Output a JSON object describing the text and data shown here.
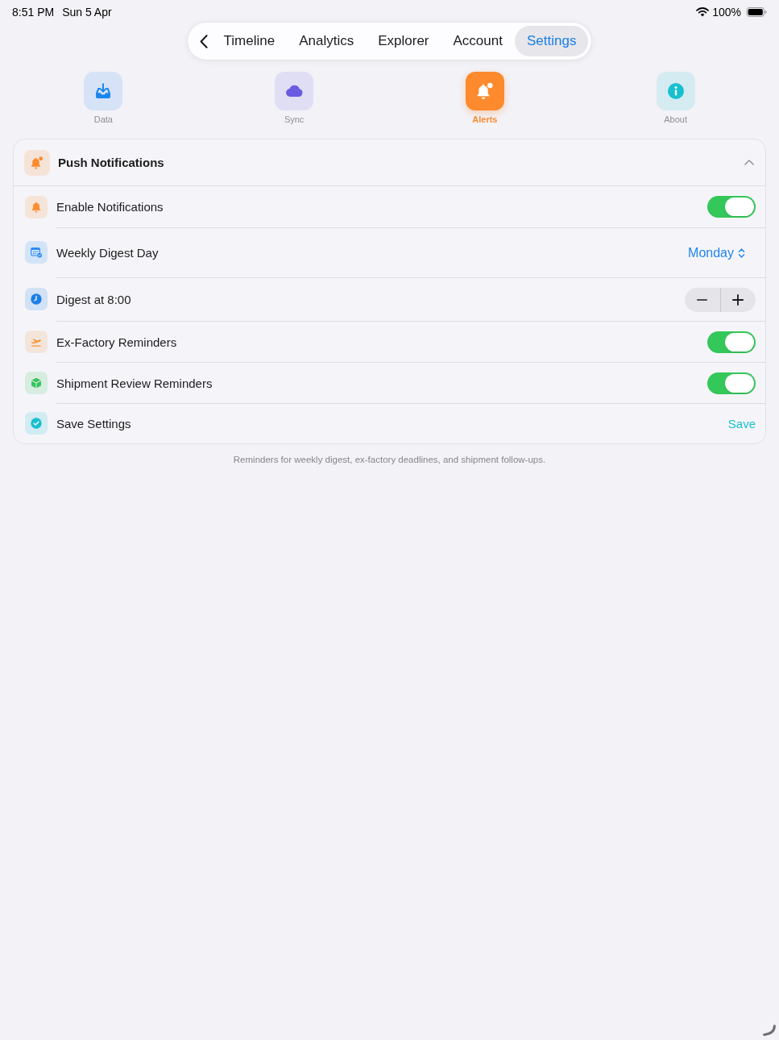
{
  "status_bar": {
    "time": "8:51 PM",
    "date": "Sun 5 Apr",
    "battery": "100%"
  },
  "nav": {
    "tabs": [
      {
        "label": "Timeline",
        "selected": false
      },
      {
        "label": "Analytics",
        "selected": false
      },
      {
        "label": "Explorer",
        "selected": false
      },
      {
        "label": "Account",
        "selected": false
      },
      {
        "label": "Settings",
        "selected": true
      }
    ]
  },
  "categories": [
    {
      "label": "Data",
      "color": "#1c86ee",
      "selected": false
    },
    {
      "label": "Sync",
      "color": "#6a5be2",
      "selected": false
    },
    {
      "label": "Alerts",
      "color": "#fd8a2d",
      "selected": true
    },
    {
      "label": "About",
      "color": "#17c0cf",
      "selected": false
    }
  ],
  "section": {
    "title": "Push Notifications",
    "color": "#fd8a2d",
    "expanded": true,
    "rows": [
      {
        "kind": "toggle",
        "label": "Enable Notifications",
        "color": "#fd8f33",
        "on": true
      },
      {
        "kind": "picker",
        "label": "Weekly Digest Day",
        "color": "#2b8cf2",
        "value": "Monday"
      },
      {
        "kind": "stepper",
        "label": "Digest at 8:00",
        "color": "#1b7fe8"
      },
      {
        "kind": "toggle",
        "label": "Ex-Factory Reminders",
        "color": "#f5963c",
        "on": true
      },
      {
        "kind": "toggle",
        "label": "Shipment Review Reminders",
        "color": "#36c45b",
        "on": true
      },
      {
        "kind": "action",
        "label": "Save Settings",
        "color": "#19bfd0",
        "action": "Save"
      }
    ]
  },
  "footer": "Reminders for weekly digest, ex-factory deadlines, and shipment follow-ups."
}
